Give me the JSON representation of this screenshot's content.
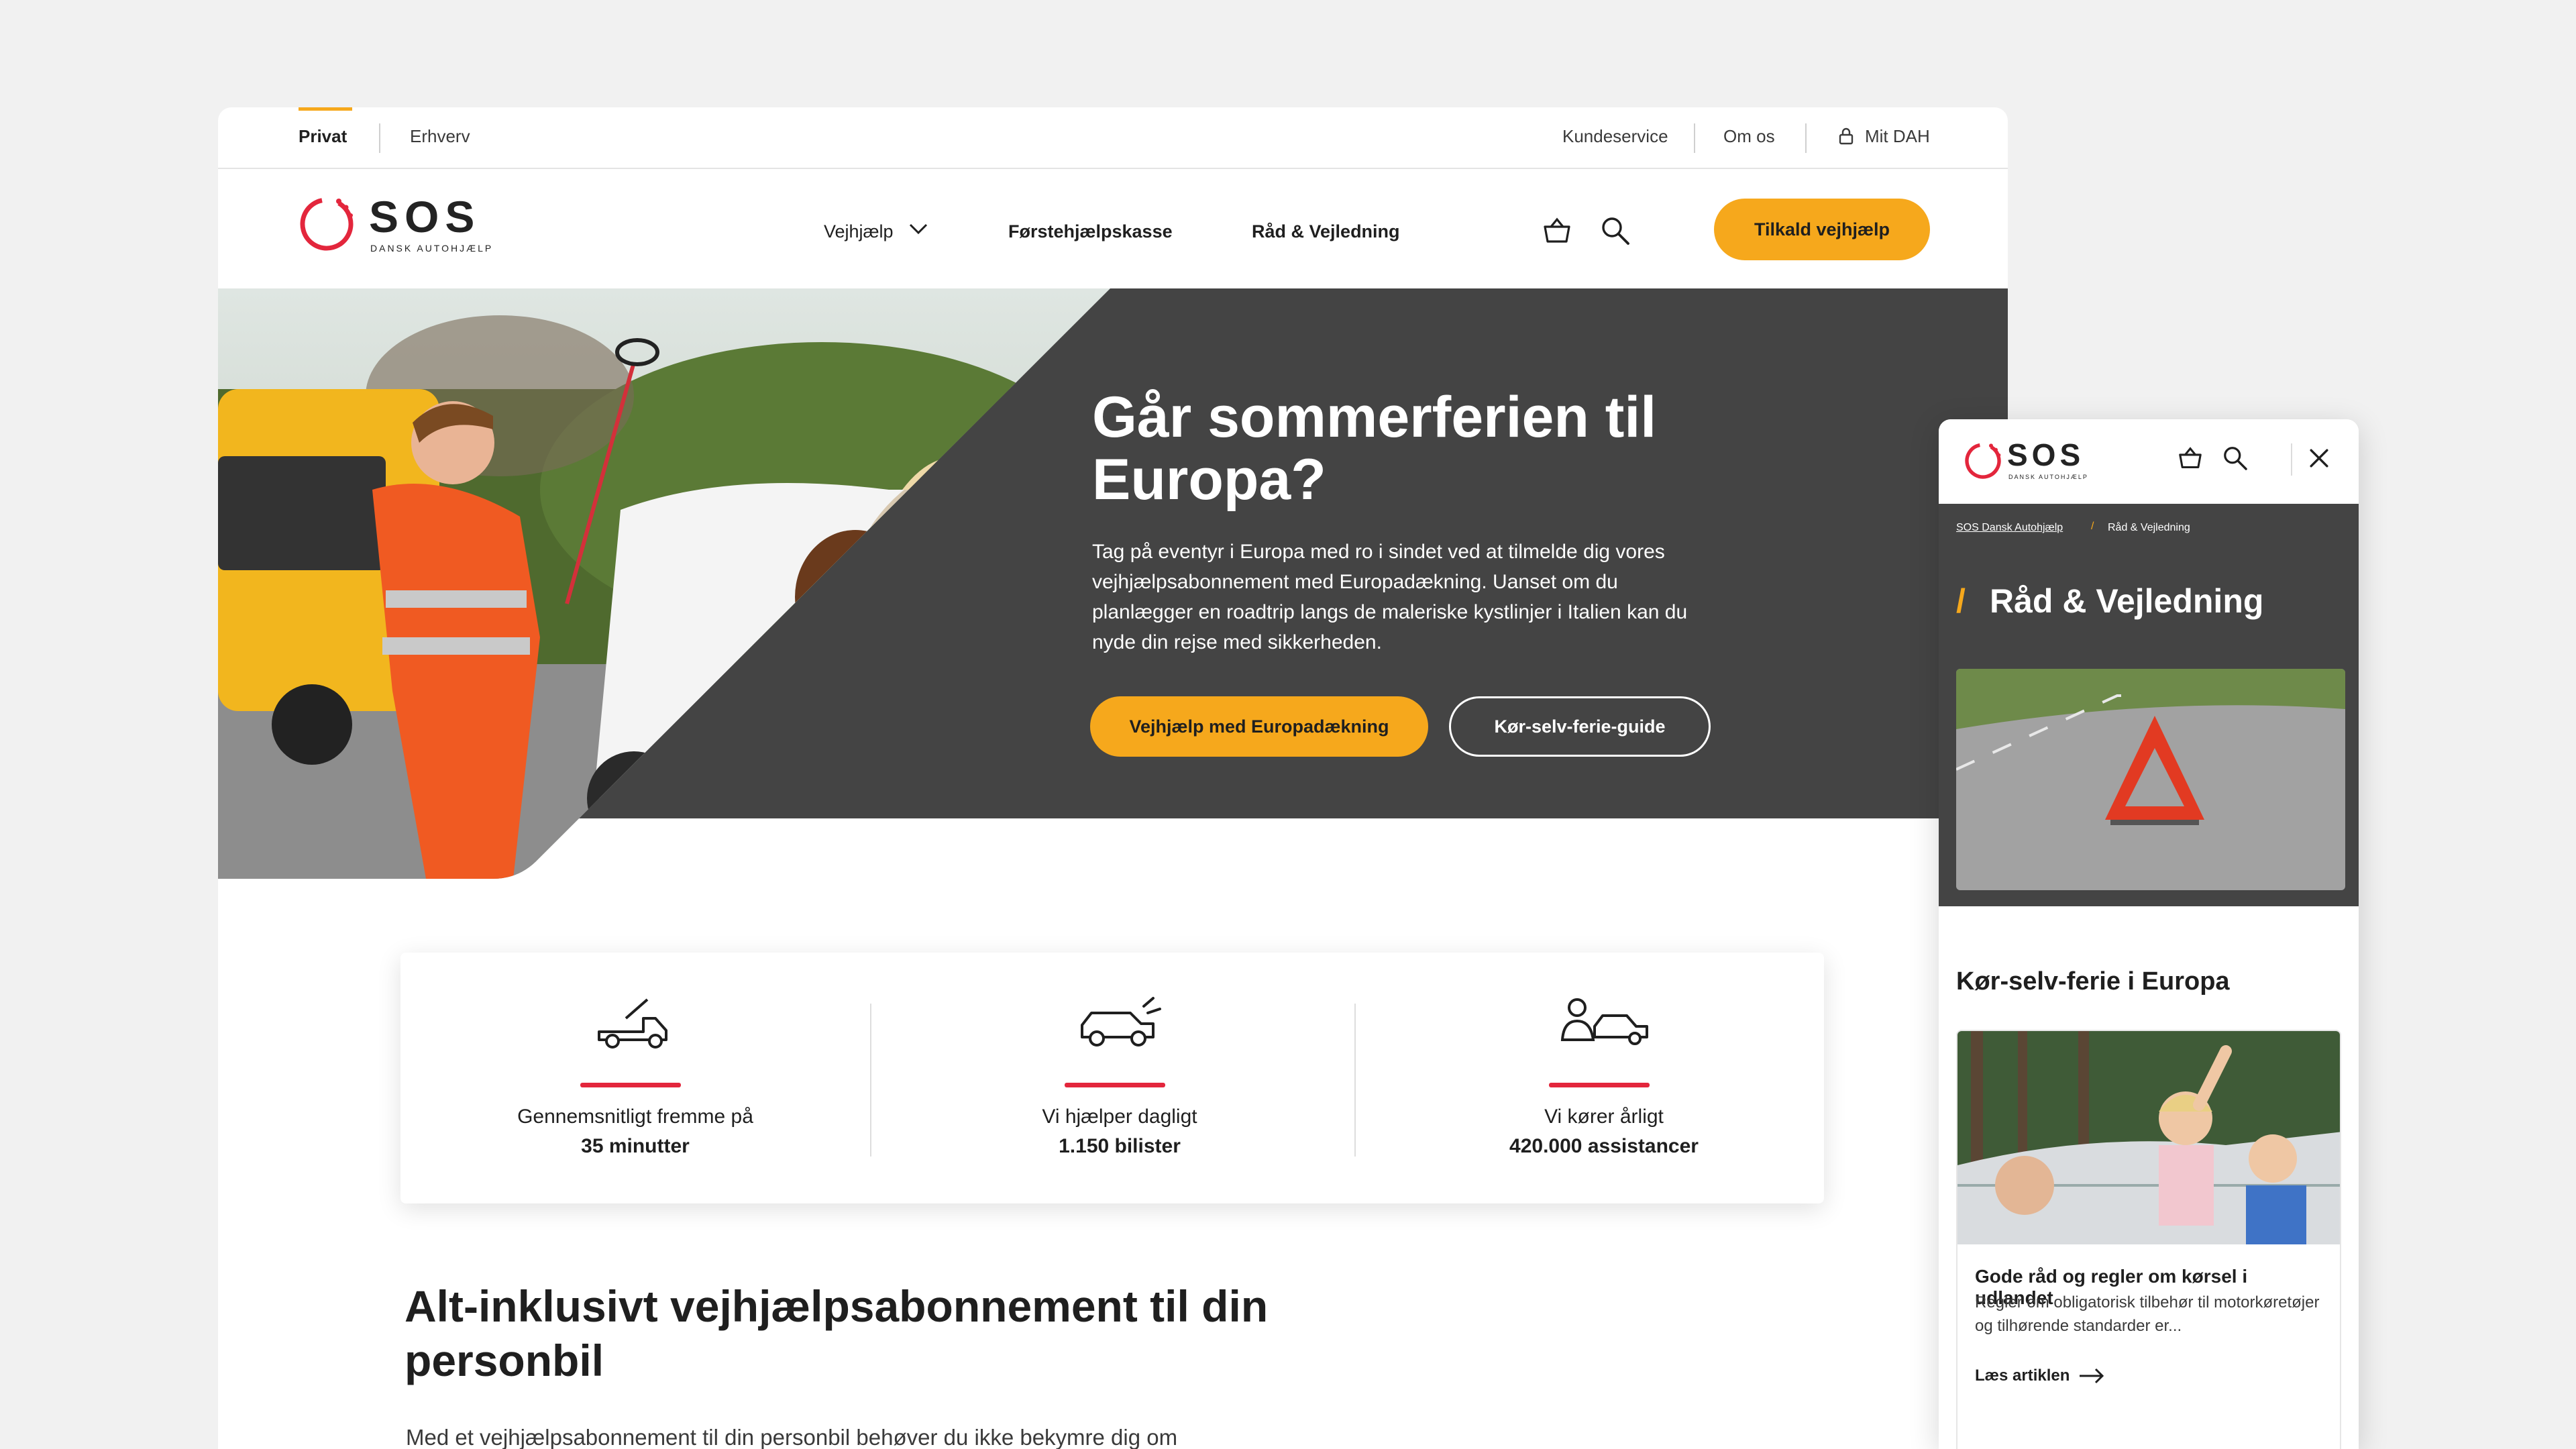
{
  "topbar": {
    "tabs": [
      "Privat",
      "Erhverv"
    ],
    "links": [
      "Kundeservice",
      "Om os",
      "Mit DAH"
    ]
  },
  "brand": {
    "name": "SOS",
    "sub": "DANSK AUTOHJÆLP",
    "accent": "#f6a81c",
    "red": "#e3263c",
    "dark": "#444444"
  },
  "nav": {
    "items": [
      "Vejhjælp",
      "Førstehjælpskasse",
      "Råd & Vejledning"
    ],
    "cta": "Tilkald vejhjælp",
    "icons": [
      "basket-icon",
      "search-icon"
    ]
  },
  "hero": {
    "title": "Går sommerferien til Europa?",
    "body": "Tag på eventyr i Europa med ro i sindet ved at tilmelde dig vores vejhjælpsabonnement med Europadækning. Uanset om du planlægger en roadtrip langs de maleriske kystlinjer i Italien kan du nyde din rejse med sikkerheden.",
    "btn_primary": "Vejhjælp med Europadækning",
    "btn_secondary": "Kør-selv-ferie-guide"
  },
  "stats": [
    {
      "icon": "tow-truck-icon",
      "line1": "Gennemsnitligt fremme på",
      "line2": "35 minutter"
    },
    {
      "icon": "broken-car-icon",
      "line1": "Vi hjælper dagligt",
      "line2": "1.150 bilister"
    },
    {
      "icon": "person-car-icon",
      "line1": "Vi kører årligt",
      "line2": "420.000 assistancer"
    }
  ],
  "section": {
    "title": "Alt-inklusivt vejhjælpsabonnement til din personbil",
    "body": "Med et vejhjælpsabonnement til din personbil behøver du ikke bekymre dig om"
  },
  "mobile": {
    "breadcrumb": [
      "SOS Dansk Autohjælp",
      "/",
      "Råd & Vejledning"
    ],
    "slash": "/",
    "title": "Råd & Vejledning",
    "section_title": "Kør-selv-ferie i Europa",
    "card": {
      "title": "Gode råd og regler om kørsel i udlandet",
      "body": "Regler om obligatorisk tilbehør til motorkøretøjer og tilhørende standarder er...",
      "link": "Læs artiklen"
    }
  }
}
